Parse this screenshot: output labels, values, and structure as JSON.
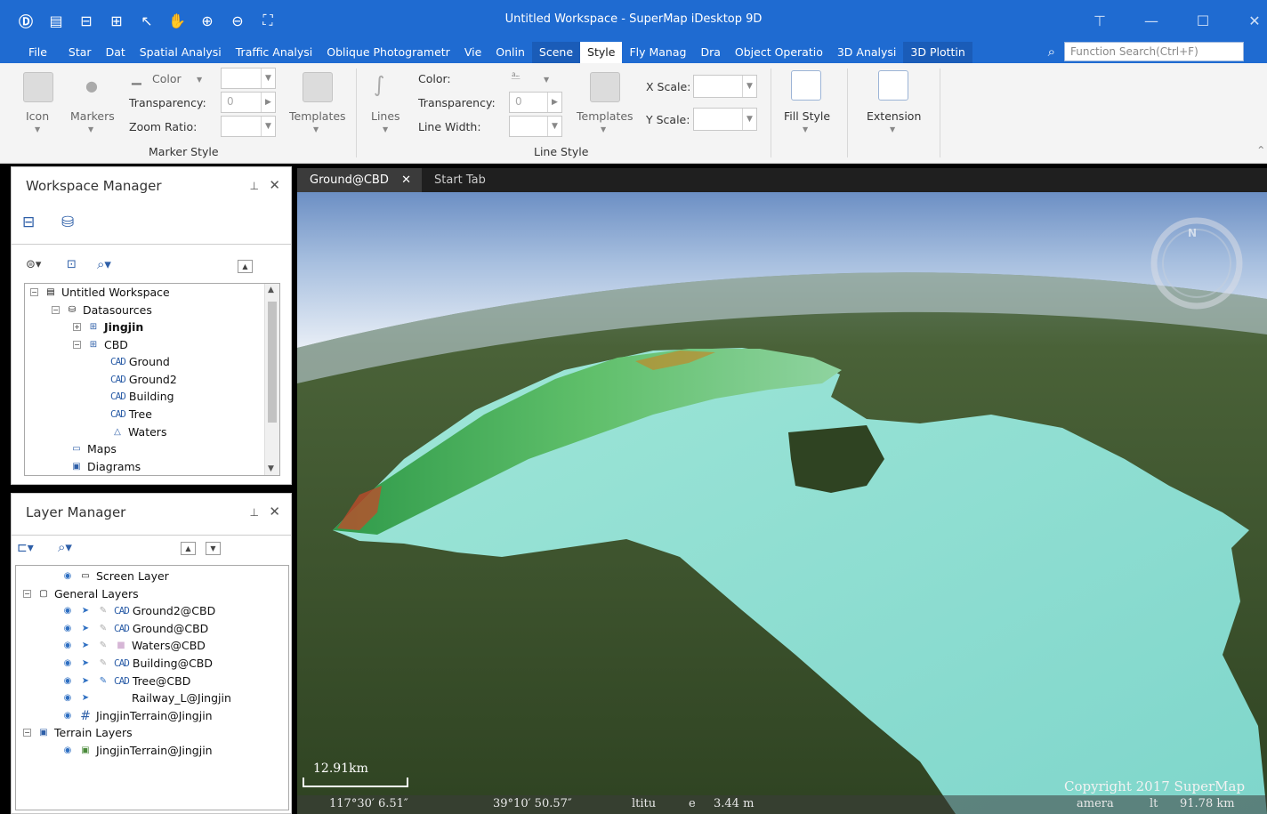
{
  "window": {
    "title": "Untitled Workspace - SuperMap iDesktop 9D"
  },
  "menu": {
    "items": [
      "File",
      "Star",
      "Dat",
      "Spatial Analysi",
      "Traffic Analysi",
      "Oblique Photogrametr",
      "Vie",
      "Onlin",
      "Scene",
      "Style",
      "Fly Manag",
      "Dra",
      "Object Operatio",
      "3D Analysi",
      "3D Plottin"
    ],
    "active": "Style",
    "search_placeholder": "Function Search(Ctrl+F)"
  },
  "ribbon": {
    "icon_label": "Icon",
    "markers_label": "Markers",
    "color_label": "Color",
    "transparency_label": "Transparency:",
    "zoom_ratio_label": "Zoom Ratio:",
    "marker_transparency_value": "0",
    "templates_label": "Templates",
    "marker_style_group": "Marker Style",
    "lines_label": "Lines",
    "line_color_label": "Color:",
    "line_transparency_label": "Transparency:",
    "line_width_label": "Line Width:",
    "line_transparency_value": "0",
    "line_templates_label": "Templates",
    "line_style_group": "Line Style",
    "x_scale_label": "X Scale:",
    "y_scale_label": "Y Scale:",
    "fill_style_label": "Fill Style",
    "extension_label": "Extension"
  },
  "workspace_manager": {
    "title": "Workspace Manager",
    "tree": {
      "workspace": "Untitled Workspace",
      "datasources": "Datasources",
      "jingjin": "Jingjin",
      "cbd": "CBD",
      "ground": "Ground",
      "ground2": "Ground2",
      "building": "Building",
      "tree": "Tree",
      "waters": "Waters",
      "maps": "Maps",
      "diagrams": "Diagrams"
    }
  },
  "layer_manager": {
    "title": "Layer Manager",
    "screen_layer": "Screen Layer",
    "general_layers": "General Layers",
    "layers": {
      "ground2": "Ground2@CBD",
      "ground": "Ground@CBD",
      "waters": "Waters@CBD",
      "building": "Building@CBD",
      "tree": "Tree@CBD",
      "railway": "Railway_L@Jingjin",
      "terrain": "JingjinTerrain@Jingjin"
    },
    "terrain_layers": "Terrain Layers",
    "terrain_layer": "JingjinTerrain@Jingjin"
  },
  "tabs": {
    "active": "Ground@CBD",
    "close": "✕",
    "start": "Start Tab"
  },
  "scene": {
    "scale_text": "12.91km",
    "copyright": "Copyright 2017 SuperMap",
    "compass_letter": "N"
  },
  "status": {
    "longitude": "117°30′ 6.51″",
    "latitude": "39°10′ 50.57″",
    "altitude_label": "ltitu",
    "altitude_unit": "e",
    "altitude_value": "3.44 m",
    "camera_label": "amera",
    "camera_h_label": "lt",
    "camera_value": "91.78 km"
  }
}
